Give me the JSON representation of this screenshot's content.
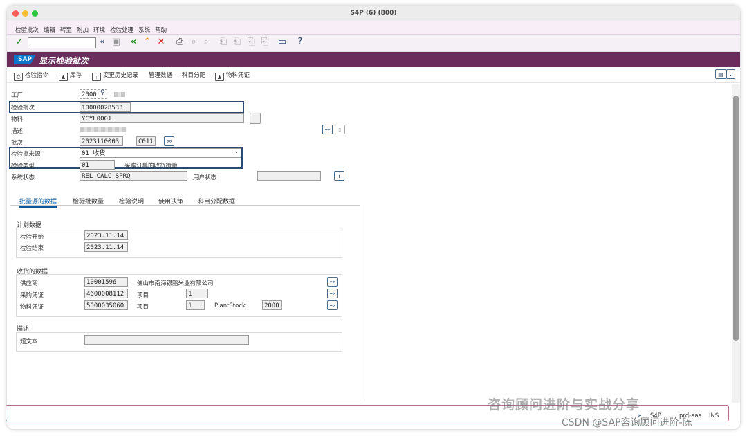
{
  "window": {
    "title": "S4P (6) (800)"
  },
  "menu": [
    "检验批次",
    "编辑",
    "转至",
    "附加",
    "环境",
    "检验处理",
    "系统",
    "帮助"
  ],
  "header": {
    "logo": "SAP",
    "title": "显示检验批次"
  },
  "app_toolbar": [
    "检验指令",
    "库存",
    "变更历史记录",
    "管理数据",
    "科目分配",
    "物料凭证"
  ],
  "form": {
    "plant": {
      "label": "工厂",
      "value": "2000"
    },
    "lot": {
      "label": "检验批次",
      "value": "10000028533"
    },
    "material": {
      "label": "物料",
      "value": "YCYL0001"
    },
    "description": {
      "label": "描述"
    },
    "batch": {
      "label": "批次",
      "value": "2023110003",
      "extra": "C011"
    },
    "lot_origin": {
      "label": "检验批来源",
      "value": "01 收货"
    },
    "insp_type": {
      "label": "检验类型",
      "value": "01",
      "text": "采购订单的收货检验"
    },
    "sys_status": {
      "label": "系统状态",
      "value": "REL  CALC SPRQ"
    },
    "user_status": {
      "label": "用户状态",
      "value": ""
    }
  },
  "tabs": [
    "批量源的数据",
    "检验批数量",
    "检验说明",
    "使用决策",
    "科目分配数据"
  ],
  "planning": {
    "title": "计划数据",
    "start": {
      "label": "检验开始",
      "value": "2023.11.14"
    },
    "end": {
      "label": "检验结束",
      "value": "2023.11.14"
    }
  },
  "goods_receipt": {
    "title": "收货的数据",
    "vendor": {
      "label": "供应商",
      "value": "10001596",
      "text": "佛山市南海银鹏米业有限公司"
    },
    "po": {
      "label": "采购凭证",
      "value": "4600008112",
      "item_label": "项目",
      "item": "1"
    },
    "matdoc": {
      "label": "物料凭证",
      "value": "5000035060",
      "item_label": "项目",
      "item": "1",
      "stock_label": "PlantStock",
      "stock": "2000"
    }
  },
  "desc_group": {
    "title": "描述",
    "short_text_label": "短文本",
    "short_text": ""
  },
  "status_bar": {
    "system": "S4P",
    "server": "prd-aas",
    "mode": "INS"
  },
  "watermark": {
    "line1": "咨询顾问进阶与实战分享",
    "line2": "CSDN @SAP咨询顾问进阶-陈"
  }
}
